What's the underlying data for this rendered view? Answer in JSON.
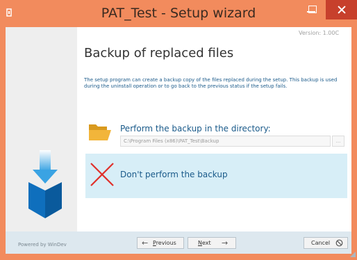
{
  "window": {
    "title": "PAT_Test - Setup wizard",
    "controls": [
      "minimize-icon",
      "maximize-icon",
      "close-icon"
    ]
  },
  "header": {
    "version": "Version: 1.00C",
    "title": "Backup of replaced files",
    "description": "The setup program can create a backup copy of the files replaced during the setup. This backup is used during the uninstall operation or to go back to the previous status if the setup fails."
  },
  "options": {
    "backup": {
      "label": "Perform the backup in the directory:",
      "path": "C:\\Program Files (x86)\\PAT_Test\\Backup",
      "browse": "...",
      "icon": "folder-icon"
    },
    "no_backup": {
      "label": "Don't perform the backup",
      "selected": true,
      "icon": "red-x-icon"
    }
  },
  "footer": {
    "powered_by": "Powered by WinDev",
    "previous_u": "P",
    "previous_rest": "revious",
    "next_u": "N",
    "next_rest": "ext",
    "cancel": "Cancel"
  },
  "colors": {
    "titlebar": "#f28b5d",
    "close": "#c7402c",
    "accent_text": "#1a5a8a",
    "selected_bg": "#d7eef7",
    "footer_bg": "#dde8ef"
  }
}
